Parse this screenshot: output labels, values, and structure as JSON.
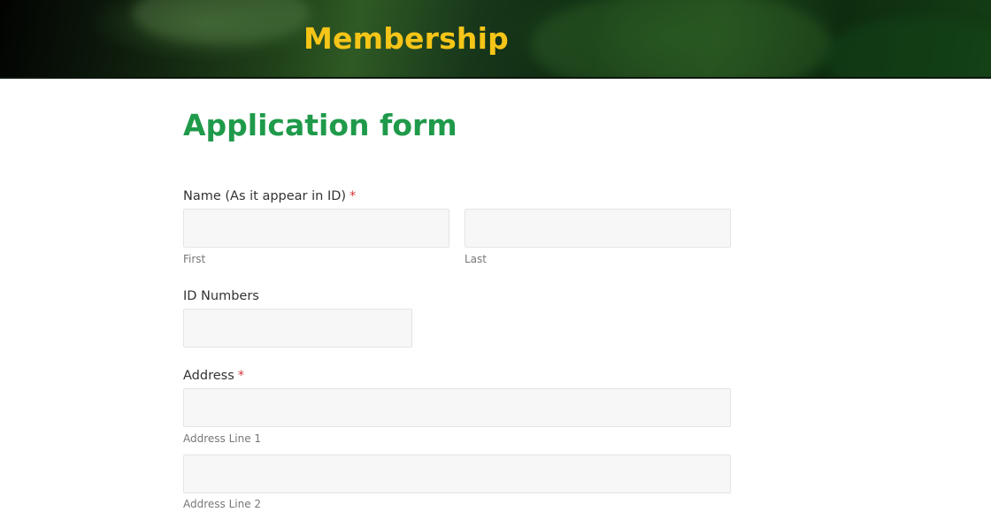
{
  "header": {
    "title": "Membership"
  },
  "form": {
    "heading": "Application form",
    "required_mark": "*",
    "name": {
      "label": "Name (As it appear in ID)",
      "first_sublabel": "First",
      "last_sublabel": "Last",
      "first_value": "",
      "last_value": ""
    },
    "id_numbers": {
      "label": "ID Numbers",
      "value": ""
    },
    "address": {
      "label": "Address",
      "line1_sublabel": "Address Line 1",
      "line2_sublabel": "Address Line 2",
      "line1_value": "",
      "line2_value": ""
    }
  },
  "colors": {
    "header_title": "#f5c518",
    "heading": "#1f9a4a",
    "required": "#d63638"
  }
}
